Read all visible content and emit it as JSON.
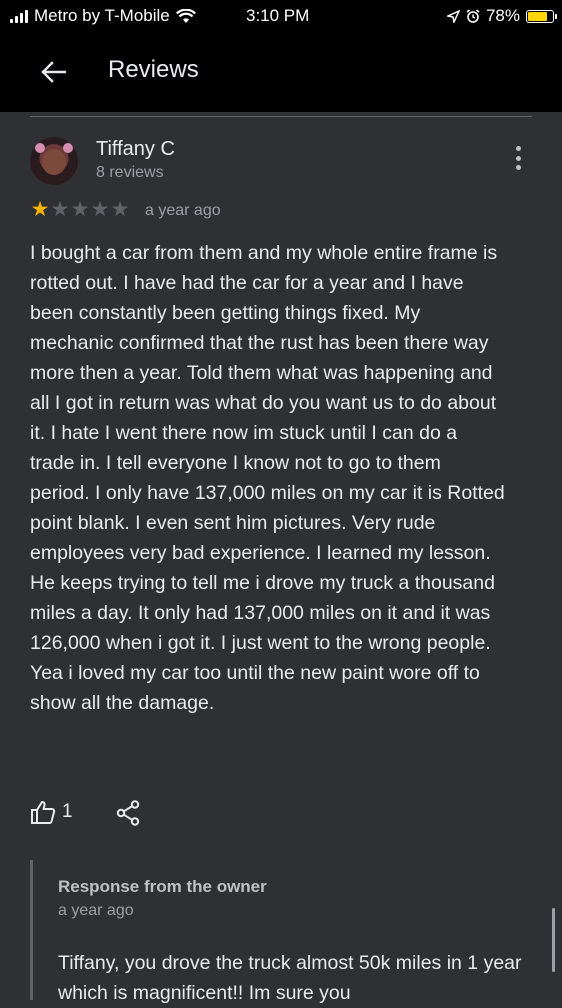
{
  "status_bar": {
    "carrier": "Metro by T-Mobile",
    "time": "3:10 PM",
    "battery": "78%",
    "battery_level": 0.78,
    "colors": {
      "battery_fill": "#ffd60a"
    }
  },
  "app_bar": {
    "title": "Reviews",
    "back_icon": "arrow-left-icon"
  },
  "review": {
    "author": "Tiffany C",
    "author_reviews": "8 reviews",
    "rating": 1,
    "max_rating": 5,
    "time": "a year ago",
    "text": "I bought a car from them and my whole entire frame is rotted out. I have had the car for a year and I have been constantly been getting things fixed. My mechanic confirmed that the rust has been there way more then a year. Told them what was happening and all I got in return was what do you want us to do about it. I hate I went there now im stuck until I can do a trade in. I tell everyone I know not to go to them period. I only have 137,000 miles on my car it is Rotted point blank. I even sent him pictures. Very rude employees very bad experience. I learned my lesson. He keeps trying to tell me i drove my truck a thousand miles a day. It only had 137,000 miles on it and it was 126,000 when i got it. I just went to the wrong people. Yea i loved my car too until the new paint wore off to show all the damage.",
    "likes": "1",
    "icons": {
      "like": "thumbs-up-icon",
      "share": "share-icon",
      "more": "more-vert-icon"
    },
    "colors": {
      "star_on": "#f4b400",
      "star_off": "#5f6368"
    }
  },
  "owner_response": {
    "title": "Response from the owner",
    "time": "a year ago",
    "text": "Tiffany, you drove the truck almost 50k miles in 1 year which is magnificent!! Im sure you"
  }
}
